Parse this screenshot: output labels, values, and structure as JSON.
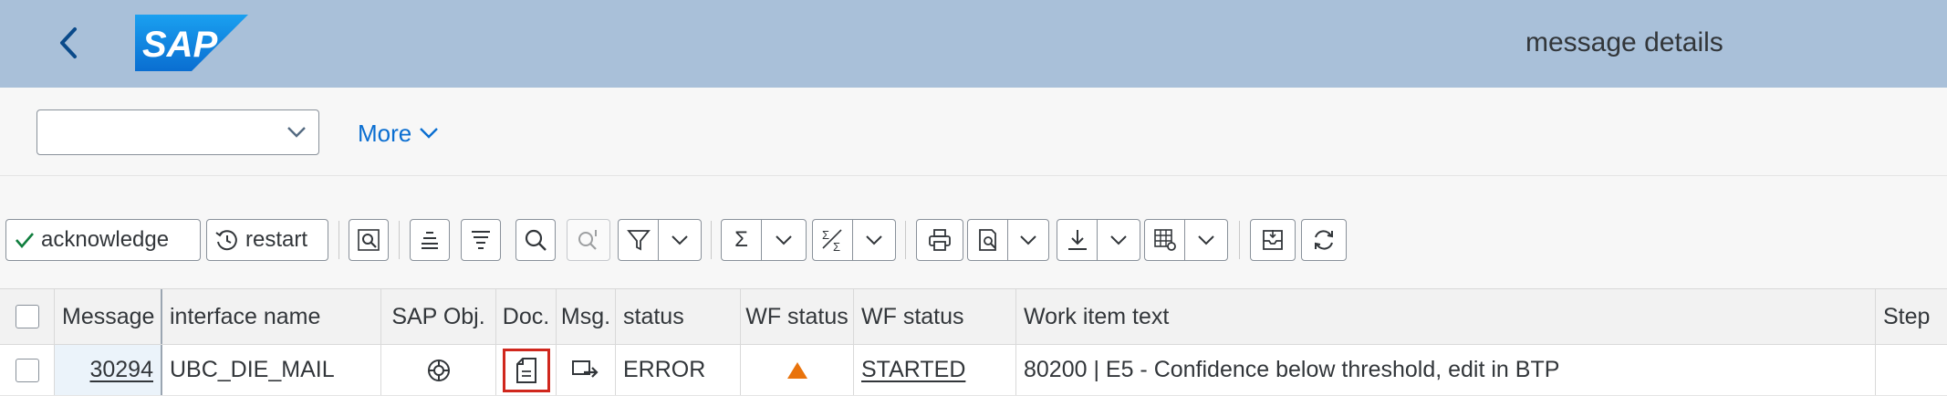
{
  "shell": {
    "title": "message details",
    "logo_text": "SAP"
  },
  "subheader": {
    "variant_value": "",
    "more_label": "More"
  },
  "toolbar": {
    "acknowledge_label": "acknowledge",
    "restart_label": "restart",
    "sum_glyph": "Σ"
  },
  "table": {
    "columns": [
      "Message",
      "interface name",
      "SAP Obj.",
      "Doc.",
      "Msg.",
      "status",
      "WF status",
      "WF status",
      "Work item text",
      "Step"
    ],
    "rows": [
      {
        "message": "30294",
        "interface_name": "UBC_DIE_MAIL",
        "sap_obj_icon": "lifebuoy-icon",
        "doc_icon": "document-icon",
        "msg_icon": "message-export-icon",
        "status": "ERROR",
        "wf_status_icon": "warning-triangle-icon",
        "wf_status": "STARTED",
        "work_item_text": "80200 | E5 - Confidence below threshold, edit in BTP",
        "step": ""
      }
    ]
  },
  "colors": {
    "shell_bg": "#a9c0d9",
    "accent": "#0a6ed1",
    "warning": "#e9730c",
    "highlight": "#d0271d",
    "check": "#107e3e"
  }
}
